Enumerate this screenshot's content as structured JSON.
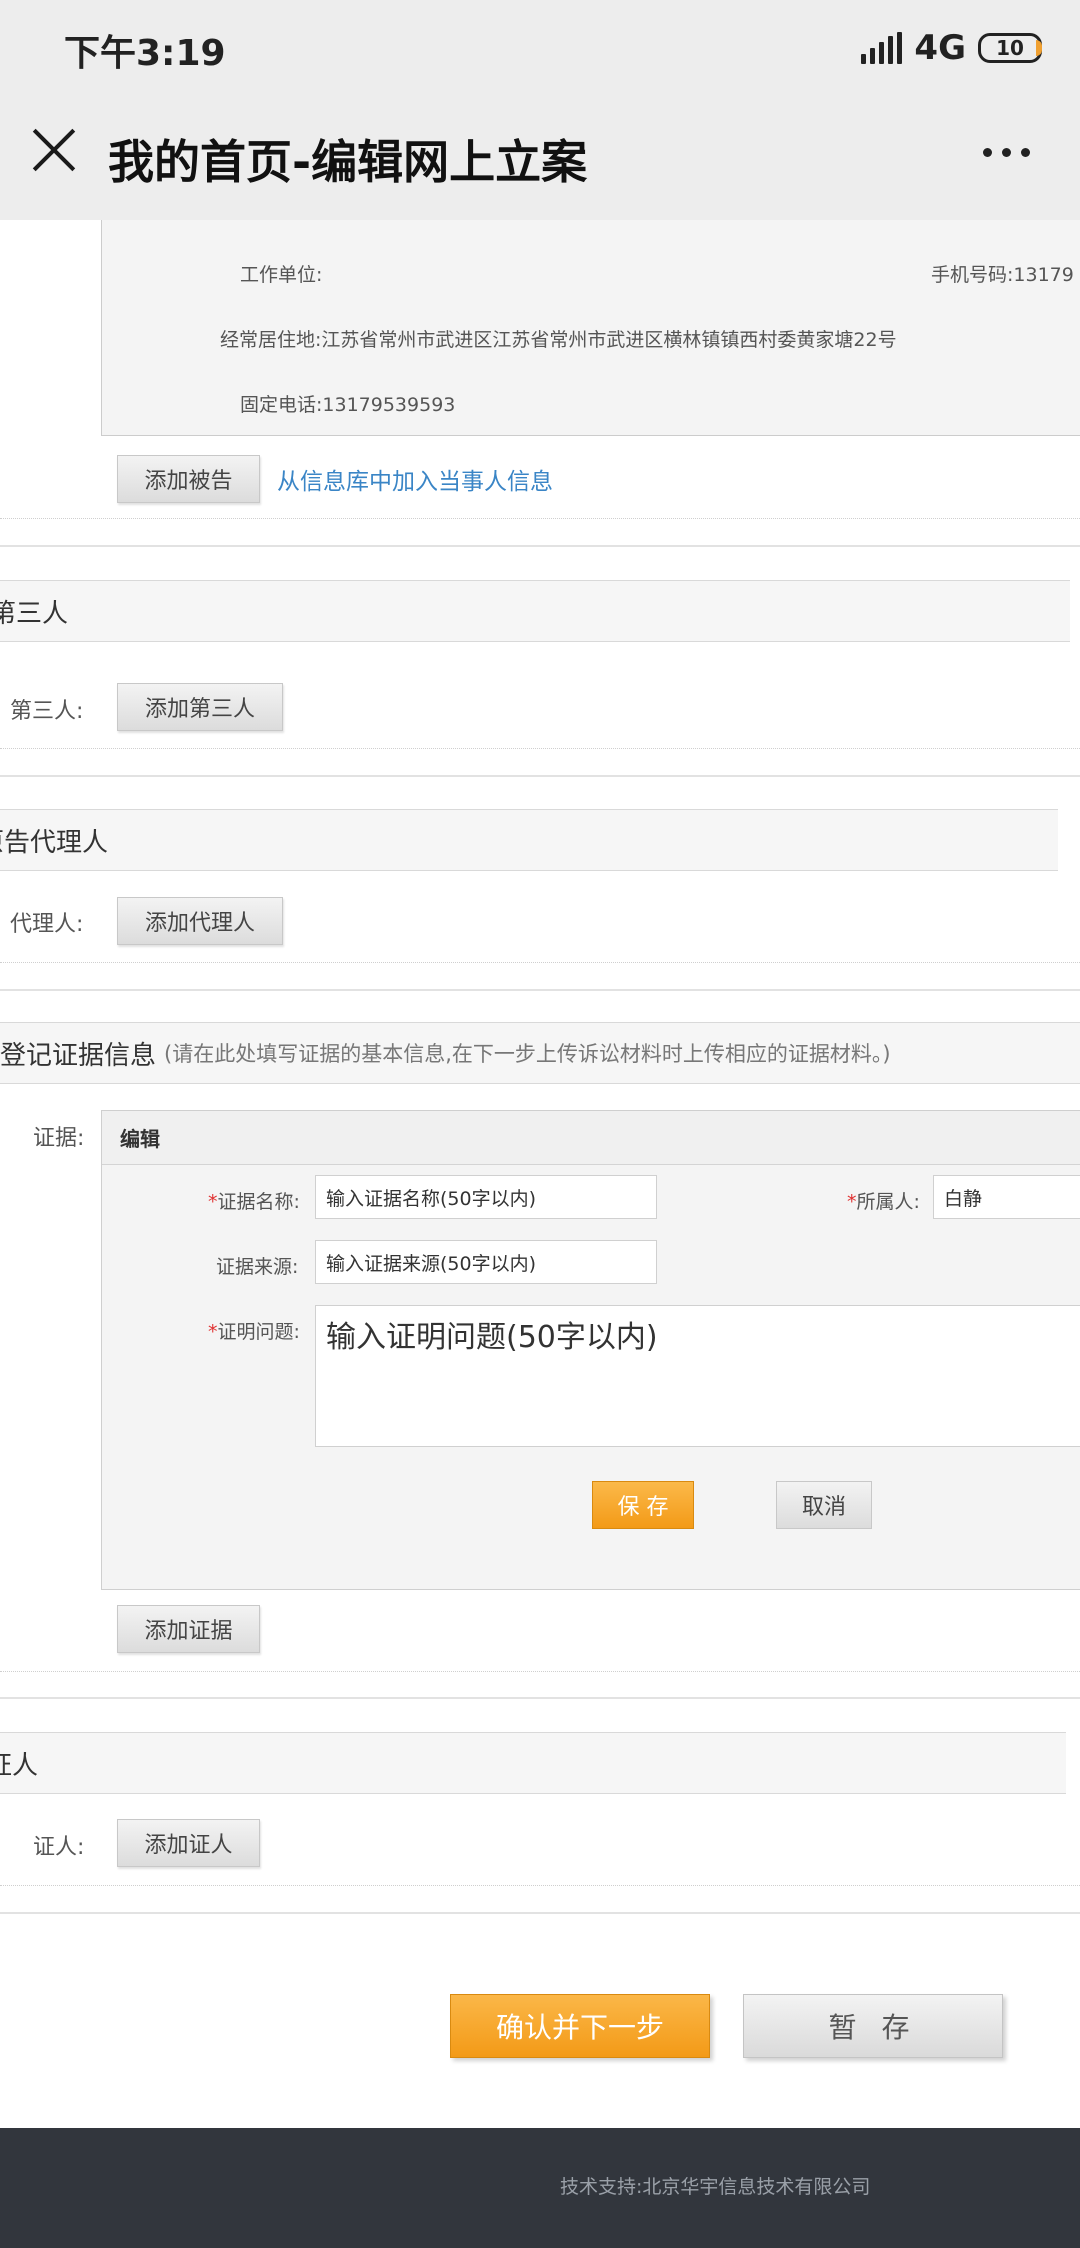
{
  "status_bar": {
    "time": "下午3:19",
    "network": "4G",
    "battery": "10"
  },
  "title_bar": {
    "title": "我的首页-编辑网上立案"
  },
  "defendant_info": {
    "work_unit_label": "工作单位:",
    "phone_label": "手机号码:",
    "phone_value_partial": "13179",
    "residence_label": "经常居住地:",
    "residence_value": "江苏省常州市武进区江苏省常州市武进区横林镇镇西村委黄家塘22号",
    "landline_label": "固定电话:",
    "landline_value": "13179539593",
    "add_button": "添加被告",
    "from_db_link": "从信息库中加入当事人信息"
  },
  "third_party": {
    "section_title": "第三人",
    "row_label": "第三人:",
    "add_button": "添加第三人"
  },
  "plaintiff_agent": {
    "section_title": "原告代理人",
    "row_label": "代理人:",
    "add_button": "添加代理人"
  },
  "evidence": {
    "section_title": "登记证据信息",
    "section_note": "(请在此处填写证据的基本信息,在下一步上传诉讼材料时上传相应的证据材料。)",
    "row_label": "证据:",
    "edit_title": "编辑",
    "required_mark": "*",
    "name_label": "证据名称:",
    "name_placeholder": "输入证据名称(50字以内)",
    "owner_label": "所属人:",
    "owner_value": "白静",
    "source_label": "证据来源:",
    "source_placeholder": "输入证据来源(50字以内)",
    "issue_label": "证明问题:",
    "issue_placeholder": "输入证明问题(50字以内)",
    "save_button": "保 存",
    "cancel_button": "取消",
    "add_button": "添加证据"
  },
  "witness": {
    "section_title": "证人",
    "row_label": "证人:",
    "add_button": "添加证人"
  },
  "actions": {
    "confirm_next": "确认并下一步",
    "save_draft": "暂 存"
  },
  "footer": {
    "support_text": "技术支持:北京华宇信息技术有限公司"
  }
}
